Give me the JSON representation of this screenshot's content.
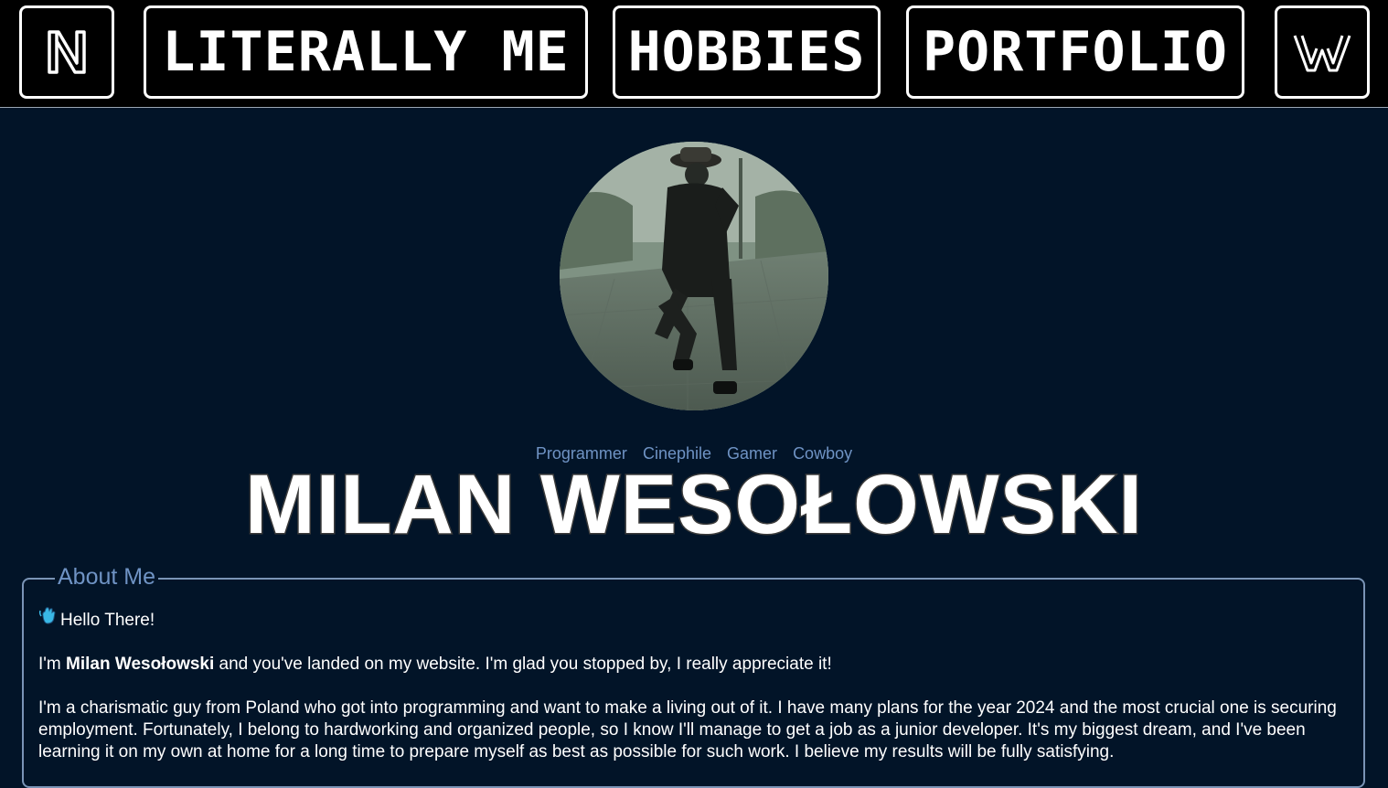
{
  "nav": {
    "logo_left": "N",
    "literally_me": "LITERALLY ME",
    "hobbies": "HOBBIES",
    "portfolio": "PORTFOLIO",
    "logo_right": "W"
  },
  "profile": {
    "tags": [
      "Programmer",
      "Cinephile",
      "Gamer",
      "Cowboy"
    ],
    "name": "MILAN WESOŁOWSKI"
  },
  "about": {
    "title": "About Me",
    "greeting": "Hello There!",
    "intro_pre": "I'm ",
    "intro_name": "Milan Wesołowski",
    "intro_post": " and you've landed on my website. I'm glad you stopped by, I really appreciate it!",
    "paragraph2": "I'm a charismatic guy from Poland who got into programming and want to make a living out of it. I have many plans for the year 2024 and the most crucial one is securing employment. Fortunately, I belong to hardworking and organized people, so I know I'll manage to get a job as a junior developer. It's my biggest dream, and I've been learning it on my own at home for a long time to prepare myself as best as possible for such work. I believe my results will be fully satisfying."
  },
  "colors": {
    "background": "#021428",
    "accent": "#6f93c4",
    "nav_bg": "#000000"
  }
}
